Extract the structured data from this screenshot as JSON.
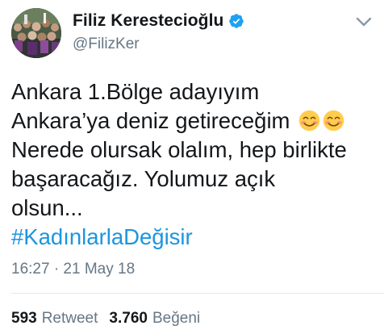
{
  "author": {
    "display_name": "Filiz Kerestecioğlu",
    "handle": "@FilizKer",
    "verified": true,
    "avatar_icon": "avatar-crowd-photo",
    "verified_icon": "verified-badge-icon"
  },
  "tweet": {
    "lines": [
      "Ankara 1.Bölge adayıyım",
      "Ankara’ya deniz getireceğim",
      "Nerede olursak olalım, hep birlikte",
      "başaracağız. Yolumuz açık",
      "olsun..."
    ],
    "emojis": [
      "smiling-face-with-smiling-eyes",
      "smiling-face-with-smiling-eyes"
    ],
    "hashtag": "#KadınlarlaDeğisir",
    "timestamp": "16:27 · 21 May 18"
  },
  "stats": {
    "retweets_count": "593",
    "retweets_label": "Retweet",
    "likes_count": "3.760",
    "likes_label": "Beğeni"
  },
  "colors": {
    "link": "#1b95e0",
    "secondary_text": "#657786",
    "primary_text": "#14171a",
    "divider": "#e1e8ed",
    "verified": "#1da1f2"
  }
}
